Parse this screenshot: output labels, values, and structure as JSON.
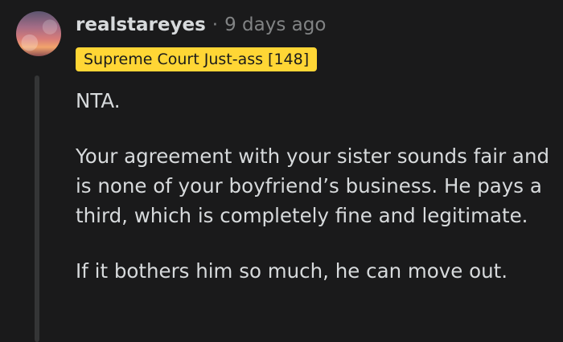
{
  "comment": {
    "username": "realstareyes",
    "separator": "·",
    "time_ago": "9 days ago",
    "flair": "Supreme Court Just-ass [148]",
    "paragraphs": [
      "NTA.",
      "Your agreement with your sister sounds fair and is none of your boyfriend’s business. He pays a third, which is completely fine and legitimate.",
      "If it bothers him so much, he can move out."
    ],
    "avatar_icon": "user-avatar-icon"
  },
  "colors": {
    "background": "#1a1a1b",
    "primary_text": "#d7dadc",
    "secondary_text": "#818384",
    "flair_background": "#ffd635",
    "thread_line": "#343536"
  }
}
